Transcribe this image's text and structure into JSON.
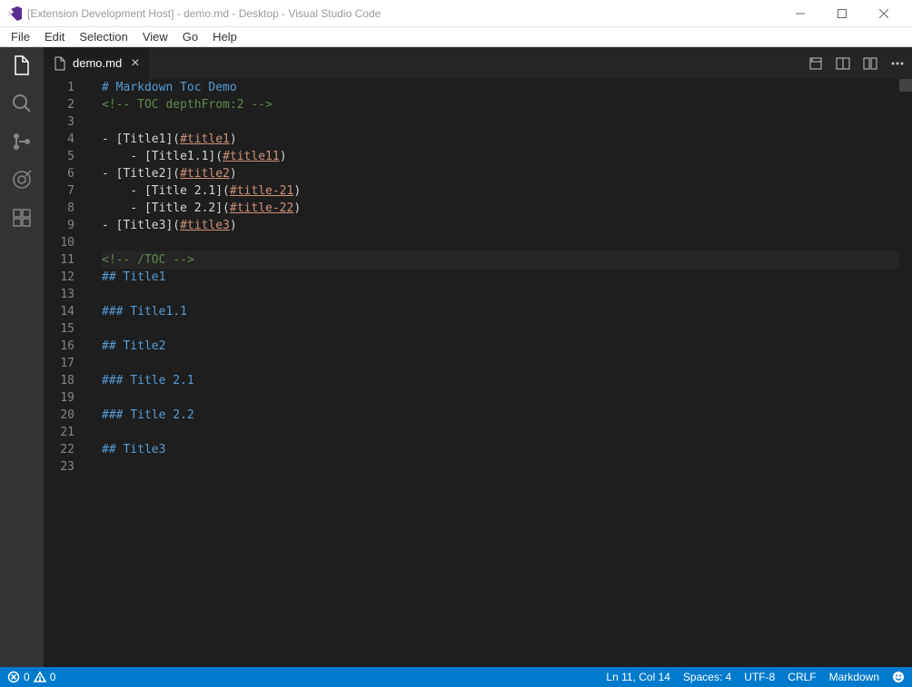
{
  "window": {
    "title": "[Extension Development Host] - demo.md - Desktop - Visual Studio Code"
  },
  "menu": {
    "file": "File",
    "edit": "Edit",
    "selection": "Selection",
    "view": "View",
    "go": "Go",
    "help": "Help"
  },
  "tab": {
    "filename": "demo.md"
  },
  "code": {
    "lines": [
      {
        "n": "1",
        "segs": [
          {
            "t": "# ",
            "c": "tok-heading"
          },
          {
            "t": "Markdown Toc Demo",
            "c": "tok-heading"
          }
        ]
      },
      {
        "n": "2",
        "segs": [
          {
            "t": "<!-- TOC depthFrom:2 -->",
            "c": "tok-comment"
          }
        ]
      },
      {
        "n": "3",
        "segs": [
          {
            "t": "",
            "c": "tok-text"
          }
        ]
      },
      {
        "n": "4",
        "segs": [
          {
            "t": "- [Title1](",
            "c": "tok-text"
          },
          {
            "t": "#title1",
            "c": "tok-link"
          },
          {
            "t": ")",
            "c": "tok-text"
          }
        ]
      },
      {
        "n": "5",
        "segs": [
          {
            "t": "    - [Title1.1](",
            "c": "tok-text"
          },
          {
            "t": "#title11",
            "c": "tok-link"
          },
          {
            "t": ")",
            "c": "tok-text"
          }
        ]
      },
      {
        "n": "6",
        "segs": [
          {
            "t": "- [Title2](",
            "c": "tok-text"
          },
          {
            "t": "#title2",
            "c": "tok-link"
          },
          {
            "t": ")",
            "c": "tok-text"
          }
        ]
      },
      {
        "n": "7",
        "segs": [
          {
            "t": "    - [Title 2.1](",
            "c": "tok-text"
          },
          {
            "t": "#title-21",
            "c": "tok-link"
          },
          {
            "t": ")",
            "c": "tok-text"
          }
        ]
      },
      {
        "n": "8",
        "segs": [
          {
            "t": "    - [Title 2.2](",
            "c": "tok-text"
          },
          {
            "t": "#title-22",
            "c": "tok-link"
          },
          {
            "t": ")",
            "c": "tok-text"
          }
        ]
      },
      {
        "n": "9",
        "segs": [
          {
            "t": "- [Title3](",
            "c": "tok-text"
          },
          {
            "t": "#title3",
            "c": "tok-link"
          },
          {
            "t": ")",
            "c": "tok-text"
          }
        ]
      },
      {
        "n": "10",
        "segs": [
          {
            "t": "",
            "c": "tok-text"
          }
        ]
      },
      {
        "n": "11",
        "segs": [
          {
            "t": "<!-- /TOC -->",
            "c": "tok-comment"
          }
        ],
        "hl": true
      },
      {
        "n": "12",
        "segs": [
          {
            "t": "## ",
            "c": "tok-heading"
          },
          {
            "t": "Title1",
            "c": "tok-heading"
          }
        ]
      },
      {
        "n": "13",
        "segs": [
          {
            "t": "",
            "c": "tok-text"
          }
        ]
      },
      {
        "n": "14",
        "segs": [
          {
            "t": "### ",
            "c": "tok-heading"
          },
          {
            "t": "Title1.1",
            "c": "tok-heading"
          }
        ]
      },
      {
        "n": "15",
        "segs": [
          {
            "t": "",
            "c": "tok-text"
          }
        ]
      },
      {
        "n": "16",
        "segs": [
          {
            "t": "## ",
            "c": "tok-heading"
          },
          {
            "t": "Title2",
            "c": "tok-heading"
          }
        ]
      },
      {
        "n": "17",
        "segs": [
          {
            "t": "",
            "c": "tok-text"
          }
        ]
      },
      {
        "n": "18",
        "segs": [
          {
            "t": "### ",
            "c": "tok-heading"
          },
          {
            "t": "Title 2.1",
            "c": "tok-heading"
          }
        ]
      },
      {
        "n": "19",
        "segs": [
          {
            "t": "",
            "c": "tok-text"
          }
        ]
      },
      {
        "n": "20",
        "segs": [
          {
            "t": "### ",
            "c": "tok-heading"
          },
          {
            "t": "Title 2.2",
            "c": "tok-heading"
          }
        ]
      },
      {
        "n": "21",
        "segs": [
          {
            "t": "",
            "c": "tok-text"
          }
        ]
      },
      {
        "n": "22",
        "segs": [
          {
            "t": "## ",
            "c": "tok-heading"
          },
          {
            "t": "Title3",
            "c": "tok-heading"
          }
        ]
      },
      {
        "n": "23",
        "segs": [
          {
            "t": "",
            "c": "tok-text"
          }
        ]
      }
    ]
  },
  "status": {
    "errors": "0",
    "warnings": "0",
    "lncol": "Ln 11, Col 14",
    "spaces": "Spaces: 4",
    "encoding": "UTF-8",
    "eol": "CRLF",
    "language": "Markdown"
  }
}
